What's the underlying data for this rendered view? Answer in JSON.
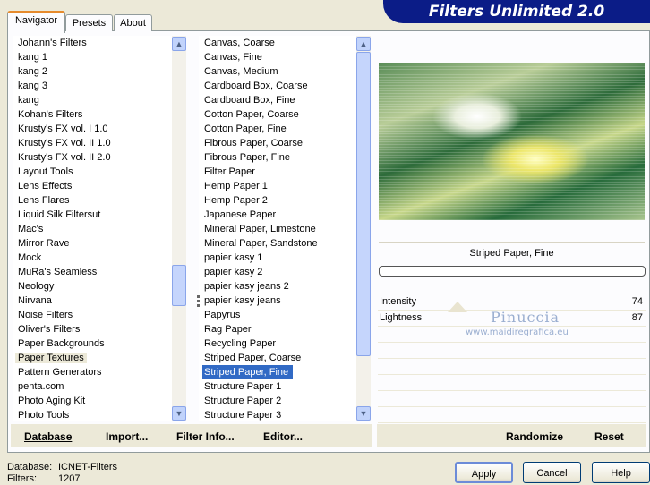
{
  "banner": {
    "title": "Filters Unlimited 2.0"
  },
  "tabs": [
    {
      "label": "Navigator"
    },
    {
      "label": "Presets"
    },
    {
      "label": "About"
    }
  ],
  "categories": {
    "items": [
      "Johann's Filters",
      "kang 1",
      "kang 2",
      "kang 3",
      "kang",
      "Kohan's Filters",
      "Krusty's FX vol. I 1.0",
      "Krusty's FX vol. II 1.0",
      "Krusty's FX vol. II 2.0",
      "Layout Tools",
      "Lens Effects",
      "Lens Flares",
      "Liquid Silk Filtersut",
      "Mac's",
      "Mirror Rave",
      "Mock",
      "MuRa's Seamless",
      "Neology",
      "Nirvana",
      "Noise Filters",
      "Oliver's Filters",
      "Paper Backgrounds",
      "Paper Textures",
      "Pattern Generators",
      "penta.com",
      "Photo Aging Kit",
      "Photo Tools"
    ],
    "selected_index": 22
  },
  "filters": {
    "items": [
      "Canvas, Coarse",
      "Canvas, Fine",
      "Canvas, Medium",
      "Cardboard Box, Coarse",
      "Cardboard Box, Fine",
      "Cotton Paper, Coarse",
      "Cotton Paper, Fine",
      "Fibrous Paper, Coarse",
      "Fibrous Paper, Fine",
      "Filter Paper",
      "Hemp Paper 1",
      "Hemp Paper 2",
      "Japanese Paper",
      "Mineral Paper, Limestone",
      "Mineral Paper, Sandstone",
      "papier kasy 1",
      "papier kasy 2",
      "papier kasy jeans 2",
      "papier kasy jeans",
      "Papyrus",
      "Rag Paper",
      "Recycling Paper",
      "Striped Paper, Coarse",
      "Striped Paper, Fine",
      "Structure Paper 1",
      "Structure Paper 2",
      "Structure Paper 3"
    ],
    "selected_index": 23
  },
  "left_buttons": {
    "database": "Database",
    "import": "Import...",
    "filter_info": "Filter Info...",
    "editor": "Editor..."
  },
  "preview": {
    "filter_name": "Striped Paper, Fine",
    "watermark_name": "Pinuccia",
    "watermark_url": "www.maidiregrafica.eu"
  },
  "params": [
    {
      "label": "Intensity",
      "value": "74"
    },
    {
      "label": "Lightness",
      "value": "87"
    }
  ],
  "right_buttons": {
    "randomize": "Randomize",
    "reset": "Reset"
  },
  "footer": {
    "database_label": "Database:",
    "database_value": "ICNET-Filters",
    "filters_label": "Filters:",
    "filters_value": "1207"
  },
  "dialog_buttons": {
    "apply": "Apply",
    "cancel": "Cancel",
    "help": "Help"
  },
  "colors": {
    "selection": "#316ac5",
    "banner": "#0b1c87",
    "tab_accent": "#e68b2c"
  }
}
